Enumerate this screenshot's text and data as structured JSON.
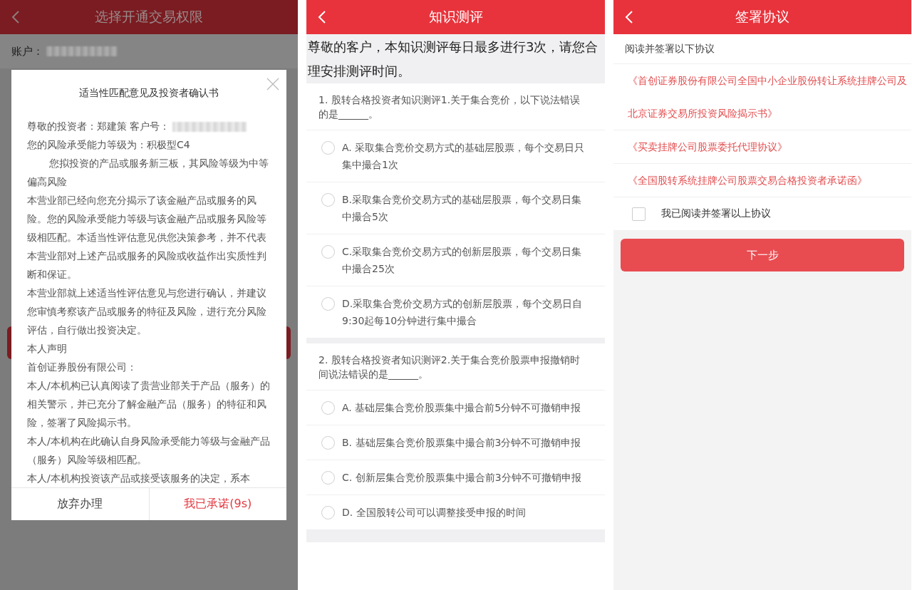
{
  "risk_screen": {
    "title": "选择开通交易权限",
    "account_label": "账户：",
    "modal": {
      "title": "适当性匹配意见及投资者确认书",
      "customer_line": "尊敬的投资者：郑建策 客户号：",
      "paragraphs": [
        {
          "kind": "plain",
          "text": "您的风险承受能力等级为：积极型C4"
        },
        {
          "kind": "indented",
          "text": "您拟投资的产品或服务新三板，其风险等级为中等偏高风险"
        },
        {
          "kind": "plain",
          "text": "本营业部已经向您充分揭示了该金融产品或服务的风险。您的风险承受能力等级与该金融产品或服务风险等级相匹配。本适当性评估意见供您决策参考，并不代表本营业部对上述产品或服务的风险或收益作出实质性判断和保证。"
        },
        {
          "kind": "plain",
          "text": "本营业部就上述适当性评估意见与您进行确认，并建议您审慎考察该产品或服务的特征及风险，进行充分风险评估，自行做出投资决定。"
        },
        {
          "kind": "plain",
          "text": "本人声明"
        },
        {
          "kind": "plain",
          "text": "首创证券股份有限公司："
        },
        {
          "kind": "plain",
          "text": "本人/本机构已认真阅读了贵营业部关于产品（服务）的相关警示，并已充分了解金融产品（服务）的特征和风险，签署了风险揭示书。"
        },
        {
          "kind": "plain",
          "text": "本人/本机构在此确认自身风险承受能力等级与金融产品（服务）风险等级相匹配。"
        },
        {
          "kind": "plain",
          "text": "本人/本机构投资该产品或接受该服务的决定，系本"
        }
      ],
      "buttons": [
        {
          "kind": "cancel",
          "label": "放弃办理"
        },
        {
          "kind": "confirm",
          "label": "我已承诺(9s)"
        }
      ]
    }
  },
  "quiz_screen": {
    "title": "知识测评",
    "notice": "尊敬的客户，本知识测评每日最多进行3次，请您合理安排测评时间。",
    "questions": [
      {
        "text": "1. 股转合格投资者知识测评1.关于集合竞价，以下说法错误的是______。",
        "options": [
          {
            "label": "A. 采取集合竞价交易方式的基础层股票，每个交易日只集中撮合1次",
            "selected": false
          },
          {
            "label": "B.采取集合竞价交易方式的基础层股票，每个交易日集中撮合5次",
            "selected": false
          },
          {
            "label": "C.采取集合竞价交易方式的创新层股票，每个交易日集中撮合25次",
            "selected": false
          },
          {
            "label": "D.采取集合竞价交易方式的创新层股票，每个交易日自9:30起每10分钟进行集中撮合",
            "selected": false
          }
        ]
      },
      {
        "text": "2. 股转合格投资者知识测评2.关于集合竞价股票申报撤销时间说法错误的是______。",
        "options": [
          {
            "label": "A. 基础层集合竞价股票集中撮合前5分钟不可撤销申报",
            "selected": false
          },
          {
            "label": "B. 基础层集合竞价股票集中撮合前3分钟不可撤销申报",
            "selected": false
          },
          {
            "label": "C. 创新层集合竞价股票集中撮合前3分钟不可撤销申报",
            "selected": false
          },
          {
            "label": "D. 全国股转公司可以调整接受申报的时间",
            "selected": false
          }
        ]
      }
    ]
  },
  "agreement_screen": {
    "title": "签署协议",
    "instruction": "阅读并签署以下协议",
    "documents": [
      "《首创证券股份有限公司全国中小企业股份转让系统挂牌公司及北京证券交易所投资风险揭示书》",
      "《买卖挂牌公司股票委托代理协议》",
      "《全国股转系统挂牌公司股票交易合格投资者承诺函》"
    ],
    "confirm_checkbox": {
      "label": "我已阅读并签署以上协议",
      "checked": false
    },
    "next_button": "下一步"
  }
}
